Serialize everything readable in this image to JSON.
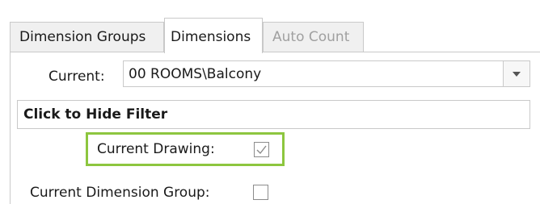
{
  "tabs": {
    "groups": "Dimension Groups",
    "dimensions": "Dimensions",
    "auto_count": "Auto Count"
  },
  "current": {
    "label": "Current:",
    "value": "00 ROOMS\\Balcony"
  },
  "filter": {
    "label": "Click to Hide Filter"
  },
  "options": {
    "current_drawing_label": "Current Drawing:",
    "current_drawing_checked": true,
    "current_dimension_group_label": "Current Dimension Group:",
    "current_dimension_group_checked": false
  },
  "colors": {
    "highlight": "#8dc63f",
    "disabled_text": "#a0a0a0"
  }
}
